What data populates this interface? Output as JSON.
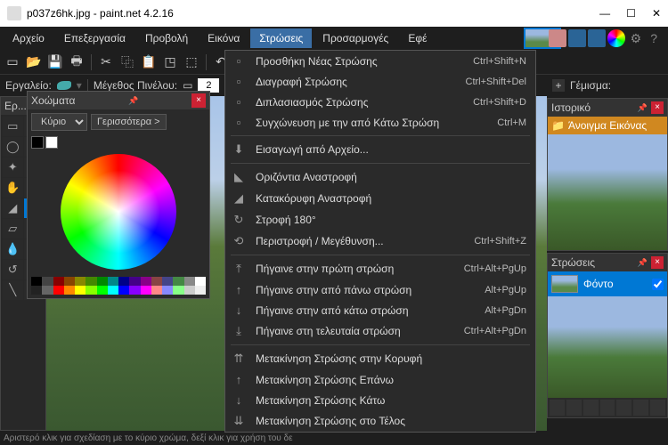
{
  "title": "p037z6hk.jpg - paint.net 4.2.16",
  "menubar": [
    "Αρχείο",
    "Επεξεργασία",
    "Προβολή",
    "Εικόνα",
    "Στρώσεις",
    "Προσαρμογές",
    "Εφέ"
  ],
  "active_menu_index": 4,
  "toolbar_icons": [
    "new-icon",
    "open-icon",
    "save-icon",
    "print-icon",
    "sep",
    "cut-icon",
    "copy-icon",
    "paste-icon",
    "crop-icon",
    "deselect-icon",
    "sep",
    "undo-icon",
    "redo-icon"
  ],
  "optionbar": {
    "tool_label": "Εργαλείο:",
    "brush_label": "Μέγεθος Πινέλου:",
    "brush_size": "2"
  },
  "fillbar": {
    "label": "Γέμισμα:"
  },
  "tools_panel": {
    "title": "Ερ...",
    "tools": [
      "select-rect",
      "move",
      "lasso",
      "move-sel",
      "wand",
      "zoom",
      "pan",
      "fill",
      "gradient",
      "brush",
      "eraser",
      "pencil",
      "picker",
      "clone",
      "recolor",
      "text",
      "line",
      "shapes"
    ]
  },
  "colors": {
    "title": "Χοώματα",
    "select_label": "Κύριο",
    "more_btn": "Γερισσότερα  >"
  },
  "history": {
    "title": "Ιστορικό",
    "item": "Άνοιγμα Εικόνας"
  },
  "layers": {
    "title": "Στρώσεις",
    "item": "Φόντο",
    "checked": true
  },
  "dropdown": [
    {
      "icon": "▫",
      "label": "Προσθήκη Νέας Στρώσης",
      "shortcut": "Ctrl+Shift+N"
    },
    {
      "icon": "▫",
      "label": "Διαγραφή Στρώσης",
      "shortcut": "Ctrl+Shift+Del"
    },
    {
      "icon": "▫",
      "label": "Διπλασιασμός Στρώσης",
      "shortcut": "Ctrl+Shift+D"
    },
    {
      "icon": "▫",
      "label": "Συγχώνευση με την από Κάτω Στρώση",
      "shortcut": "Ctrl+M"
    },
    {
      "sep": true
    },
    {
      "icon": "⬇",
      "label": "Εισαγωγή από Αρχείο..."
    },
    {
      "sep": true
    },
    {
      "icon": "◣",
      "label": "Οριζόντια Αναστροφή"
    },
    {
      "icon": "◢",
      "label": "Κατακόρυφη Αναστροφή"
    },
    {
      "icon": "↻",
      "label": "Στροφή 180°"
    },
    {
      "icon": "⟲",
      "label": "Περιστροφή / Μεγέθυνση...",
      "shortcut": "Ctrl+Shift+Z"
    },
    {
      "sep": true
    },
    {
      "icon": "⤒",
      "label": "Πήγαινε στην πρώτη στρώση",
      "shortcut": "Ctrl+Alt+PgUp"
    },
    {
      "icon": "↑",
      "label": "Πήγαινε στην από πάνω στρώση",
      "shortcut": "Alt+PgUp"
    },
    {
      "icon": "↓",
      "label": "Πήγαινε στην από κάτω στρώση",
      "shortcut": "Alt+PgDn"
    },
    {
      "icon": "⤓",
      "label": "Πήγαινε στη τελευταία στρώση",
      "shortcut": "Ctrl+Alt+PgDn"
    },
    {
      "sep": true
    },
    {
      "icon": "⇈",
      "label": "Μετακίνηση Στρώσης στην Κορυφή"
    },
    {
      "icon": "↑",
      "label": "Μετακίνηση Στρώσης Επάνω"
    },
    {
      "icon": "↓",
      "label": "Μετακίνηση Στρώσης Κάτω"
    },
    {
      "icon": "⇊",
      "label": "Μετακίνηση Στρώσης στο Τέλος"
    }
  ],
  "statusbar": "Αριστερό κλικ για σχεδίαση με το κύριο χρώμα, δεξί κλικ για χρήση του δε",
  "palette_colors": [
    "#000",
    "#444",
    "#800",
    "#840",
    "#880",
    "#480",
    "#080",
    "#088",
    "#008",
    "#408",
    "#808",
    "#844",
    "#448",
    "#484",
    "#888",
    "#fff",
    "#222",
    "#666",
    "#f00",
    "#f80",
    "#ff0",
    "#8f0",
    "#0f0",
    "#0ff",
    "#00f",
    "#80f",
    "#f0f",
    "#f88",
    "#88f",
    "#8f8",
    "#ccc",
    "#eee"
  ]
}
